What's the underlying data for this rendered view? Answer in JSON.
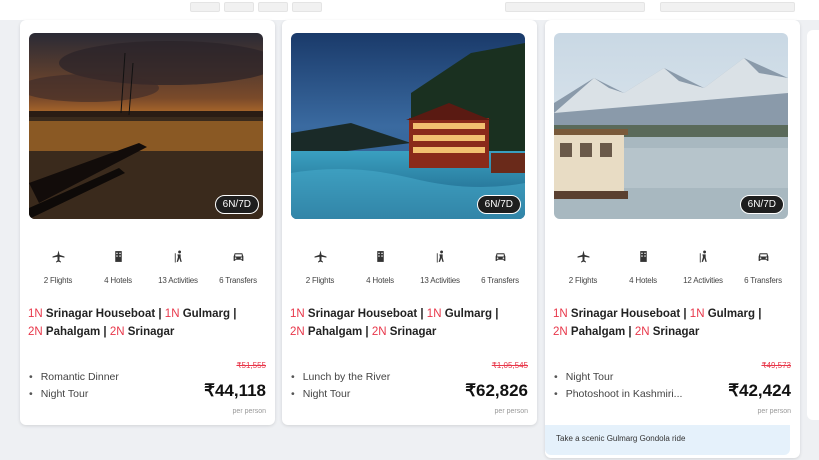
{
  "packages": [
    {
      "duration": "6N/7D",
      "amenities": [
        {
          "icon": "flight-icon",
          "label": "2 Flights"
        },
        {
          "icon": "hotel-icon",
          "label": "4 Hotels"
        },
        {
          "icon": "activity-icon",
          "label": "13 Activities"
        },
        {
          "icon": "car-icon",
          "label": "6 Transfers"
        }
      ],
      "itinerary": [
        {
          "nights": "1N",
          "place": "Srinagar Houseboat"
        },
        {
          "nights": "1N",
          "place": "Gulmarg"
        },
        {
          "nights": "2N",
          "place": "Pahalgam"
        },
        {
          "nights": "2N",
          "place": "Srinagar"
        }
      ],
      "inclusions": [
        "Romantic Dinner",
        "Night Tour"
      ],
      "old_price": "₹51,555",
      "price": "₹44,118",
      "price_note": "per person"
    },
    {
      "duration": "6N/7D",
      "amenities": [
        {
          "icon": "flight-icon",
          "label": "2 Flights"
        },
        {
          "icon": "hotel-icon",
          "label": "4 Hotels"
        },
        {
          "icon": "activity-icon",
          "label": "13 Activities"
        },
        {
          "icon": "car-icon",
          "label": "6 Transfers"
        }
      ],
      "itinerary": [
        {
          "nights": "1N",
          "place": "Srinagar Houseboat"
        },
        {
          "nights": "1N",
          "place": "Gulmarg"
        },
        {
          "nights": "2N",
          "place": "Pahalgam"
        },
        {
          "nights": "2N",
          "place": "Srinagar"
        }
      ],
      "inclusions": [
        "Lunch by the River",
        "Night Tour"
      ],
      "old_price": "₹1,05,545",
      "price": "₹62,826",
      "price_note": "per person"
    },
    {
      "duration": "6N/7D",
      "amenities": [
        {
          "icon": "flight-icon",
          "label": "2 Flights"
        },
        {
          "icon": "hotel-icon",
          "label": "4 Hotels"
        },
        {
          "icon": "activity-icon",
          "label": "12 Activities"
        },
        {
          "icon": "car-icon",
          "label": "6 Transfers"
        }
      ],
      "itinerary": [
        {
          "nights": "1N",
          "place": "Srinagar Houseboat"
        },
        {
          "nights": "1N",
          "place": "Gulmarg"
        },
        {
          "nights": "2N",
          "place": "Pahalgam"
        },
        {
          "nights": "2N",
          "place": "Srinagar"
        }
      ],
      "inclusions": [
        "Night Tour",
        "Photoshoot in Kashmiri..."
      ],
      "old_price": "₹49,573",
      "price": "₹42,424",
      "price_note": "per person",
      "tip": "Take a scenic Gulmarg Gondola ride"
    }
  ],
  "colors": {
    "accent": "#e8374a",
    "tip_bg": "#e5f1fb"
  }
}
